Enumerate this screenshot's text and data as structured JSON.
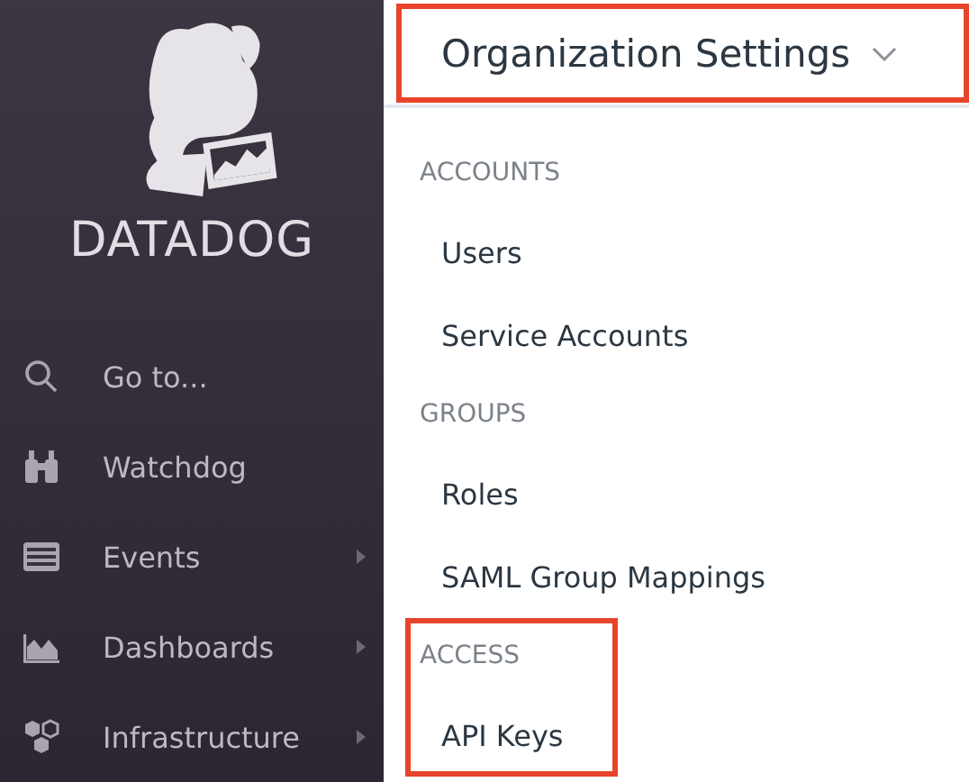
{
  "sidebar": {
    "brand": "DATADOG",
    "items": [
      {
        "label": "Go to...",
        "kind": "search",
        "has_submenu": false
      },
      {
        "label": "Watchdog",
        "kind": "binoculars",
        "has_submenu": false
      },
      {
        "label": "Events",
        "kind": "list",
        "has_submenu": true
      },
      {
        "label": "Dashboards",
        "kind": "chart",
        "has_submenu": true
      },
      {
        "label": "Infrastructure",
        "kind": "hexagons",
        "has_submenu": true
      }
    ]
  },
  "header": {
    "title": "Organization Settings",
    "highlighted": true
  },
  "sections": [
    {
      "heading": "ACCOUNTS",
      "highlighted": false,
      "items": [
        {
          "label": "Users"
        },
        {
          "label": "Service Accounts"
        }
      ]
    },
    {
      "heading": "GROUPS",
      "highlighted": false,
      "items": [
        {
          "label": "Roles"
        },
        {
          "label": "SAML Group Mappings"
        }
      ]
    },
    {
      "heading": "ACCESS",
      "highlighted": true,
      "items": [
        {
          "label": "API Keys"
        }
      ]
    }
  ]
}
